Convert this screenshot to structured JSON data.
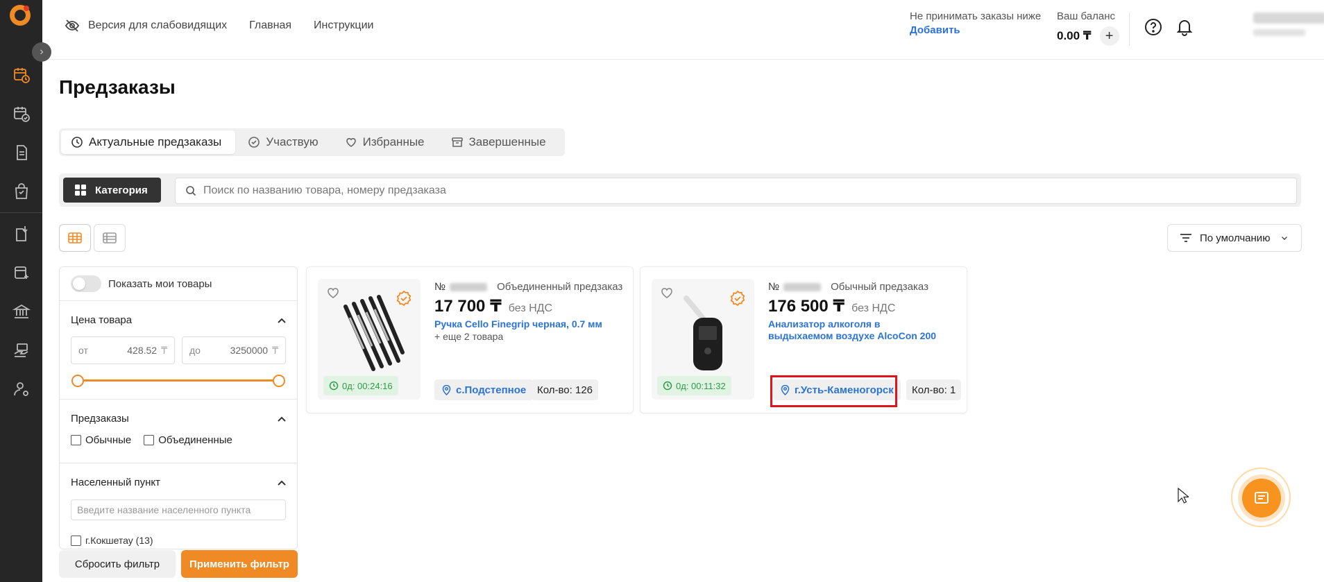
{
  "header": {
    "accessibility_label": "Версия для слабовидящих",
    "nav": [
      "Главная",
      "Инструкции"
    ],
    "orders_threshold_label": "Не принимать заказы ниже",
    "orders_add_link": "Добавить",
    "balance_label": "Ваш баланс",
    "balance_value": "0.00 ₸",
    "balance_add": "+"
  },
  "page": {
    "title": "Предзаказы"
  },
  "tabs": [
    {
      "label": "Актуальные предзаказы",
      "icon": "clock-icon",
      "active": true
    },
    {
      "label": "Участвую",
      "icon": "check-circle-icon",
      "active": false
    },
    {
      "label": "Избранные",
      "icon": "heart-icon",
      "active": false
    },
    {
      "label": "Завершенные",
      "icon": "archive-icon",
      "active": false
    }
  ],
  "search": {
    "category_button": "Категория",
    "placeholder": "Поиск по названию товара, номеру предзаказа"
  },
  "sort": {
    "label": "По умолчанию"
  },
  "filter": {
    "show_my_products": "Показать мои товары",
    "price_heading": "Цена товара",
    "price_from_label": "от",
    "price_from_value": "428.52",
    "price_to_label": "до",
    "price_to_value": "3250000",
    "currency": "₸",
    "preorders_heading": "Предзаказы",
    "preorder_types": [
      "Обычные",
      "Объединенные"
    ],
    "locality_heading": "Населенный пункт",
    "locality_placeholder": "Введите название населенного пункта",
    "localities": [
      "г.Кокшетау (13)"
    ],
    "reset_button": "Сбросить фильтр",
    "apply_button": "Применить фильтр"
  },
  "cards": [
    {
      "number_prefix": "№",
      "type": "Объединенный предзаказ",
      "price": "17 700 ₸",
      "vat": "без НДС",
      "name": "Ручка Cello Finegrip черная, 0.7 мм",
      "more": "+ еще 2 товара",
      "timer": "0д: 00:24:16",
      "location": "с.Подстепное",
      "quantity": "Кол-во: 126",
      "image_icon": "pens-icon"
    },
    {
      "number_prefix": "№",
      "type": "Обычный предзаказ",
      "price": "176 500 ₸",
      "vat": "без НДС",
      "name": "Анализатор алкоголя в выдыхаемом воздухе AlcoCon 200",
      "more": "",
      "timer": "0д: 00:11:32",
      "location": "г.Усть-Каменогорск",
      "quantity": "Кол-во: 1",
      "image_icon": "breathalyzer-icon"
    }
  ],
  "colors": {
    "accent": "#f08a24",
    "link": "#2b73d6",
    "sidebar": "#262626",
    "timer_bg": "#e1f4e4",
    "highlight": "#e0141a"
  }
}
